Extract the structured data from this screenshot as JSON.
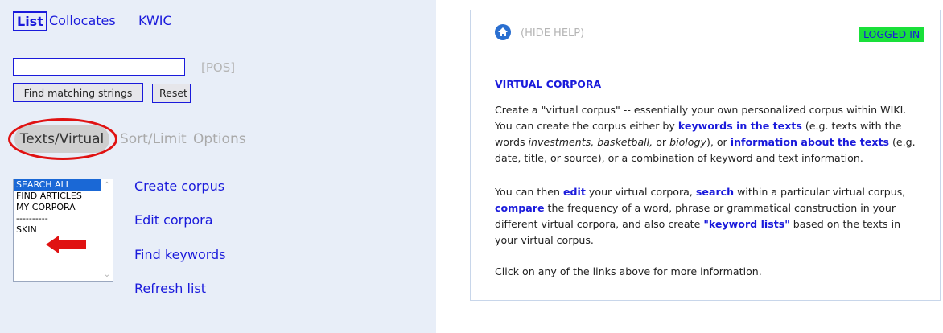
{
  "nav": {
    "list": "List",
    "collocates": "Collocates",
    "kwic": "KWIC"
  },
  "search": {
    "pos_label": "[POS]",
    "find_button": "Find matching strings",
    "reset_button": "Reset",
    "input_value": ""
  },
  "sections": {
    "texts_virtual": "Texts/Virtual",
    "sort_limit": "Sort/Limit",
    "options": "Options"
  },
  "corpus_list": {
    "options": [
      "SEARCH ALL",
      "FIND ARTICLES",
      "MY CORPORA",
      "----------",
      "SKIN"
    ],
    "selected": "SEARCH ALL"
  },
  "actions": {
    "create": "Create corpus",
    "edit": "Edit corpora",
    "keywords": "Find keywords",
    "refresh": "Refresh list"
  },
  "help": {
    "hide_help": "(HIDE HELP)",
    "logged_in": "LOGGED IN",
    "title": "VIRTUAL CORPORA",
    "p1": {
      "t1": "Create a \"virtual corpus\" -- essentially your own personalized corpus within WIKI. You can create the corpus either by ",
      "k1": "keywords in the texts",
      "t2": " (e.g. texts with the words ",
      "em1": "investments, basketball,",
      "t3": " or ",
      "em2": "biology",
      "t4": "), or ",
      "k2": "information about the texts",
      "t5": " (e.g. date, title, or source), or a combination of keyword and text information."
    },
    "p2": {
      "t1": "You can then ",
      "k1": "edit",
      "t2": " your virtual corpora, ",
      "k2": "search",
      "t3": " within a particular virtual corpus, ",
      "k3": "compare",
      "t4": " the frequency of a word, phrase or grammatical construction in your different virtual corpora, and also create ",
      "k4": "\"keyword lists\"",
      "t5": " based on the texts in your virtual corpus."
    },
    "p3": "Click on any of the links above for more information."
  },
  "colors": {
    "link": "#1a1adb",
    "highlight_ring": "#e01212",
    "logged_in_bg": "#19e03a",
    "panel_bg": "#e8eef8"
  },
  "icons": {
    "home": "home-icon",
    "annotation_arrow": "red-arrow-icon",
    "annotation_circle": "red-circle-highlight"
  }
}
